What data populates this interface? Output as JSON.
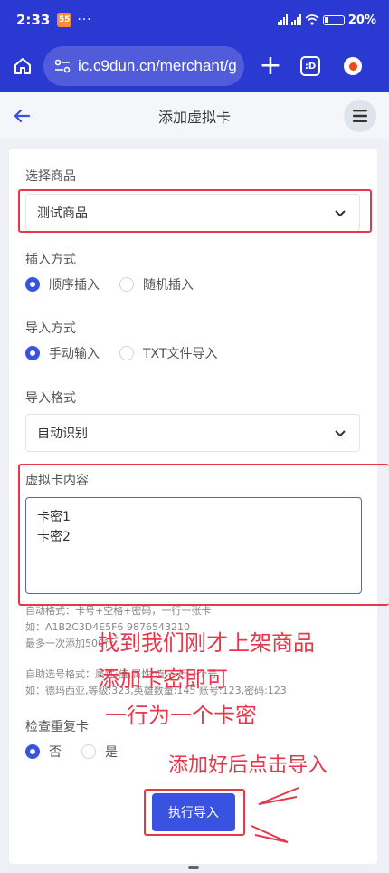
{
  "status_bar": {
    "time": "2:33",
    "app_badge": "55",
    "more": "···",
    "battery": "20%"
  },
  "browser": {
    "url": "ic.c9dun.cn/merchant/g",
    "tab_count": ":D"
  },
  "header": {
    "title": "添加虚拟卡"
  },
  "form": {
    "product_label": "选择商品",
    "product_value": "测试商品",
    "insert_label": "插入方式",
    "insert_options": [
      "顺序插入",
      "随机插入"
    ],
    "import_label": "导入方式",
    "import_options": [
      "手动输入",
      "TXT文件导入"
    ],
    "format_label": "导入格式",
    "format_value": "自动识别",
    "content_label": "虚拟卡内容",
    "content_lines": [
      "卡密1",
      "卡密2"
    ],
    "hint_lines": [
      "自动格式：卡号+空格+密码，一行一张卡",
      "如：A1B2C3D4E5F6 9876543210",
      "最多一次添加500行",
      "自助选号格式：属性:值,属性:值 一行一个号",
      "如：德玛西亚,等级:323,英雄数量:145 账号:123,密码:123"
    ],
    "dup_label": "检查重复卡",
    "dup_options": [
      "否",
      "是"
    ],
    "submit_label": "执行导入"
  },
  "annotations": {
    "note_lines": [
      "找到我们刚才上架商品",
      "添加卡密即可",
      "一行为一个卡密"
    ],
    "note_submit": "添加好后点击导入",
    "color": "#e8364a"
  }
}
